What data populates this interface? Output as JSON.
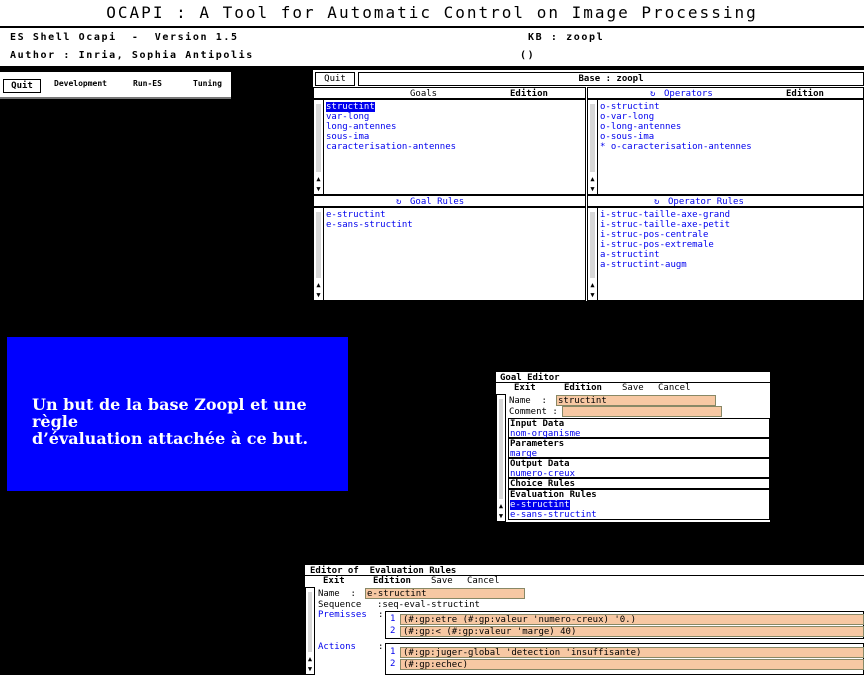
{
  "title": "OCAPI : A Tool for Automatic Control on Image Processing",
  "info": {
    "shell": "ES Shell Ocapi  -  Version 1.5",
    "author": "Author : Inria, Sophia Antipolis",
    "kb": "KB : zoopl",
    "paren": "()"
  },
  "left_menu": {
    "quit": "Quit",
    "items": [
      "Development",
      "Run-ES",
      "Tuning"
    ]
  },
  "base": {
    "quit": "Quit",
    "title": "Base : zoopl",
    "goals": {
      "header": "Goals",
      "edition": "Edition",
      "items": [
        "structint",
        "var-long",
        "long-antennes",
        "sous-ima",
        "caracterisation-antennes"
      ],
      "selected": 0
    },
    "operators": {
      "header": "Operators",
      "edition": "Edition",
      "items": [
        "o-structint",
        "o-var-long",
        "o-long-antennes",
        "o-sous-ima",
        "* o-caracterisation-antennes"
      ]
    },
    "goal_rules": {
      "header": "Goal Rules",
      "items": [
        "e-structint",
        "e-sans-structint"
      ]
    },
    "operator_rules": {
      "header": "Operator Rules",
      "items": [
        "i-struc-taille-axe-grand",
        "i-struc-taille-axe-petit",
        "i-struc-pos-centrale",
        "i-struc-pos-extremale",
        "a-structint",
        "a-structint-augm"
      ]
    }
  },
  "caption": {
    "line1": "Un but de la base Zoopl et une règle",
    "line2": "d’évaluation attachée à ce but."
  },
  "goal_editor": {
    "title": "Goal Editor",
    "menu": [
      "Exit",
      "Edition",
      "Save",
      "Cancel"
    ],
    "name_label": "Name  :",
    "name_value": "structint",
    "comment_label": "Comment :",
    "input_data_label": "Input Data",
    "input_data_value": "nom-organisme",
    "parameters_label": "Parameters",
    "parameters_value": "marge",
    "output_data_label": "Output Data",
    "output_data_value": "numero-creux",
    "choice_rules_label": "Choice Rules",
    "evaluation_rules_label": "Evaluation Rules",
    "evaluation_rules": [
      "e-structint",
      "e-sans-structint"
    ]
  },
  "eval_editor": {
    "title": "Editor of  Evaluation Rules",
    "menu": [
      "Exit",
      "Edition",
      "Save",
      "Cancel"
    ],
    "name_label": "Name  :",
    "name_value": "e-structint",
    "sequence_label": "Sequence",
    "sequence_value": ":seq-eval-structint",
    "premisses_label": "Premisses",
    "premisses": [
      {
        "num": "1",
        "text": "(#:gp:etre (#:gp:valeur 'numero-creux) '0.)"
      },
      {
        "num": "2",
        "text": "(#:gp:< (#:gp:valeur 'marge) 40)"
      }
    ],
    "actions_label": "Actions",
    "actions": [
      {
        "num": "1",
        "text": "(#:gp:juger-global 'detection 'insuffisante)"
      },
      {
        "num": "2",
        "text": "(#:gp:echec)"
      }
    ],
    "colon": ":"
  },
  "colors": {
    "background": "#000000",
    "selection": "#0000ee",
    "caption_bg": "#0000ff",
    "field_bg": "#f7c8a3"
  }
}
